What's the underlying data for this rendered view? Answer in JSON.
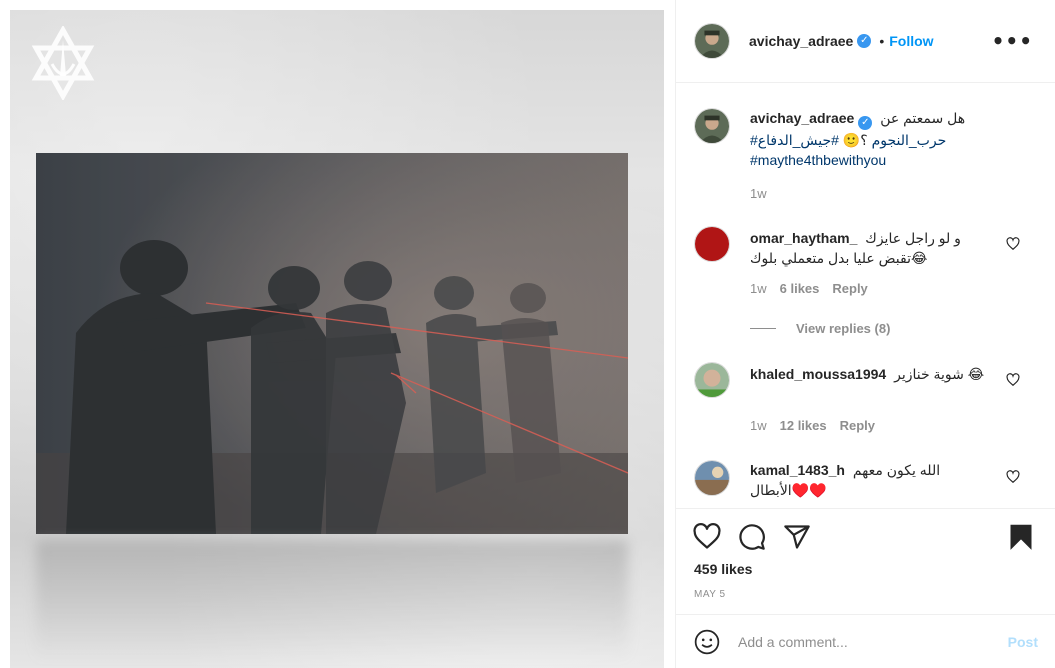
{
  "header": {
    "username": "avichay_adraee",
    "dot": "•",
    "follow_label": "Follow",
    "more_label": "•••"
  },
  "caption": {
    "username": "avichay_adraee",
    "text_line1": "هل سمعتم عن",
    "hashtag1": "#حرب_النجوم",
    "text_mid": "؟🙂",
    "hashtag2": "#جيش_الدفاع",
    "hashtag3": "#maythe4thbewithyou",
    "time": "1w"
  },
  "comments": [
    {
      "username": "omar_haytham_",
      "text": "و لو راجل عايزك تقبض عليا بدل متعملي بلوك😂",
      "time": "1w",
      "likes": "6 likes",
      "reply_label": "Reply",
      "view_replies": "View replies (8)"
    },
    {
      "username": "khaled_moussa1994",
      "text": "شوية خنازير 😂",
      "time": "1w",
      "likes": "12 likes",
      "reply_label": "Reply"
    },
    {
      "username": "kamal_1483_h",
      "text": "الله يكون معهم الأبطال♥️♥️"
    }
  ],
  "post": {
    "likes": "459 likes",
    "date": "MAY 5"
  },
  "add_comment": {
    "placeholder": "Add a comment...",
    "post_label": "Post"
  },
  "colors": {
    "follow_blue": "#0095f6",
    "verified_blue": "#3897f0",
    "post_disabled": "#b2dffc"
  },
  "icons": [
    "like-icon",
    "comment-icon",
    "share-icon",
    "save-icon",
    "emoji-icon",
    "heart-icon",
    "verified-icon"
  ]
}
